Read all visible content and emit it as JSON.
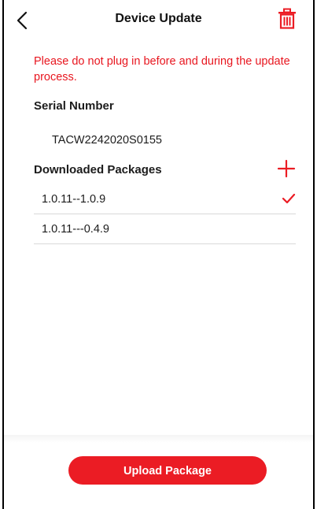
{
  "header": {
    "title": "Device Update",
    "back_icon": "chevron-left-icon",
    "delete_icon": "trash-icon"
  },
  "warning_text": "Please do not plug in before and during the update process.",
  "serial": {
    "label": "Serial Number",
    "value": "TACW2242020S0155"
  },
  "packages": {
    "label": "Downloaded Packages",
    "add_icon": "plus-icon",
    "items": [
      {
        "label": "1.0.11--1.0.9",
        "selected": true
      },
      {
        "label": "1.0.11---0.4.9",
        "selected": false
      }
    ]
  },
  "footer": {
    "upload_label": "Upload Package"
  },
  "colors": {
    "accent": "#eb1c24",
    "warning": "#e8161f",
    "text": "#1c1c1c",
    "divider": "#d9d9d9"
  }
}
